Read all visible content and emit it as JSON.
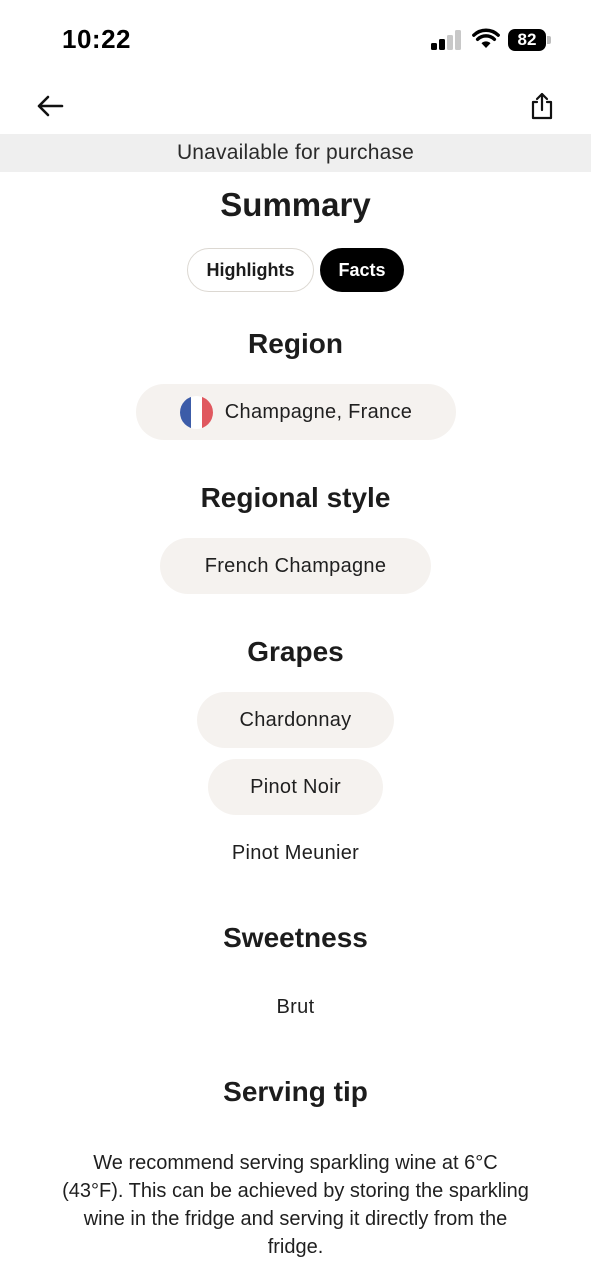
{
  "status_bar": {
    "time": "10:22",
    "battery": "82"
  },
  "nav": {
    "back_icon": "arrow-left-icon",
    "share_icon": "share-icon"
  },
  "banner": {
    "text": "Unavailable for purchase"
  },
  "summary": {
    "title": "Summary",
    "tabs": [
      {
        "label": "Highlights",
        "selected": false
      },
      {
        "label": "Facts",
        "selected": true
      }
    ]
  },
  "region": {
    "title": "Region",
    "value": "Champagne, France",
    "flag_icon": "france-flag-icon"
  },
  "regional_style": {
    "title": "Regional style",
    "value": "French Champagne"
  },
  "grapes": {
    "title": "Grapes",
    "items": [
      "Chardonnay",
      "Pinot Noir",
      "Pinot Meunier"
    ]
  },
  "sweetness": {
    "title": "Sweetness",
    "value": "Brut"
  },
  "serving_tip": {
    "title": "Serving tip",
    "text": "We recommend serving sparkling wine at 6°C (43°F). This can be achieved by storing the sparkling wine in the fridge and serving it directly from the fridge."
  },
  "colors": {
    "banner_bg": "#efefef",
    "pill_bg": "#f5f2ef",
    "active_tab_bg": "#000000"
  }
}
